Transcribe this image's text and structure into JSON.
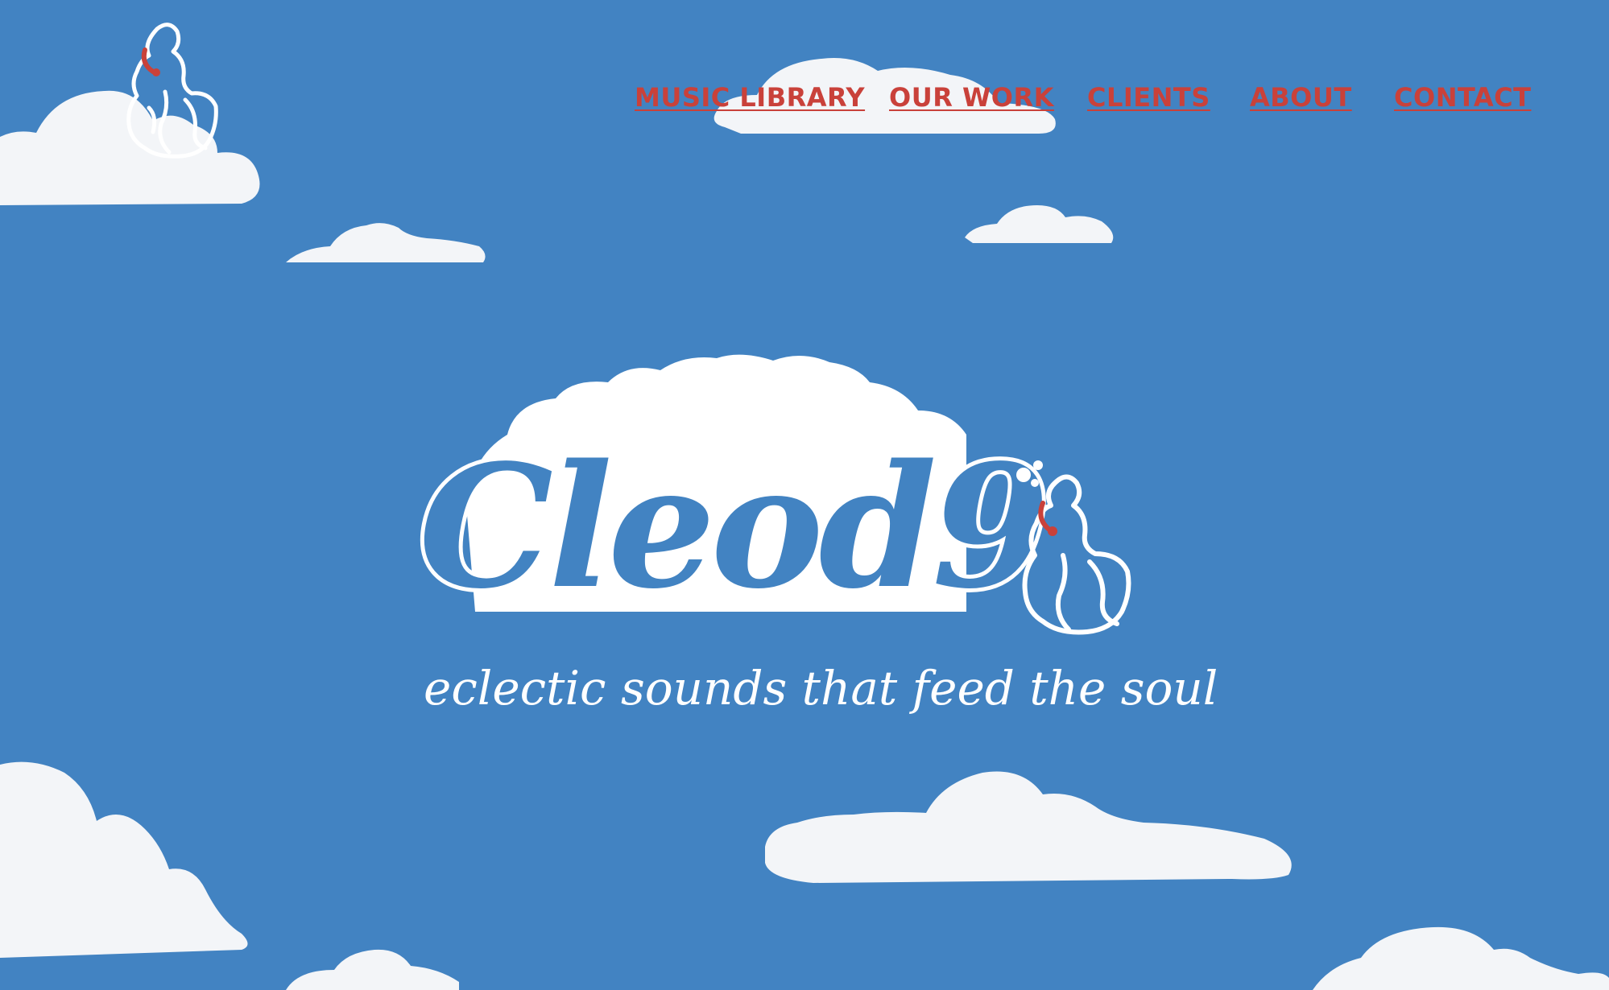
{
  "nav": {
    "items": [
      {
        "label": "MUSIC LIBRARY"
      },
      {
        "label": "OUR WORK"
      },
      {
        "label": "CLIENTS"
      },
      {
        "label": "ABOUT"
      },
      {
        "label": "CONTACT"
      }
    ]
  },
  "hero": {
    "brand": "Cleod9",
    "tagline": "eclectic sounds that feed the soul"
  },
  "colors": {
    "sky": "#4283c2",
    "nav_link": "#c9413a",
    "cloud": "#f4f6f9",
    "headphones": "#c9413a"
  },
  "icons": {
    "corner_logo": "listener-on-cloud-logo",
    "hero_figure": "listener-with-headphones-icon"
  }
}
